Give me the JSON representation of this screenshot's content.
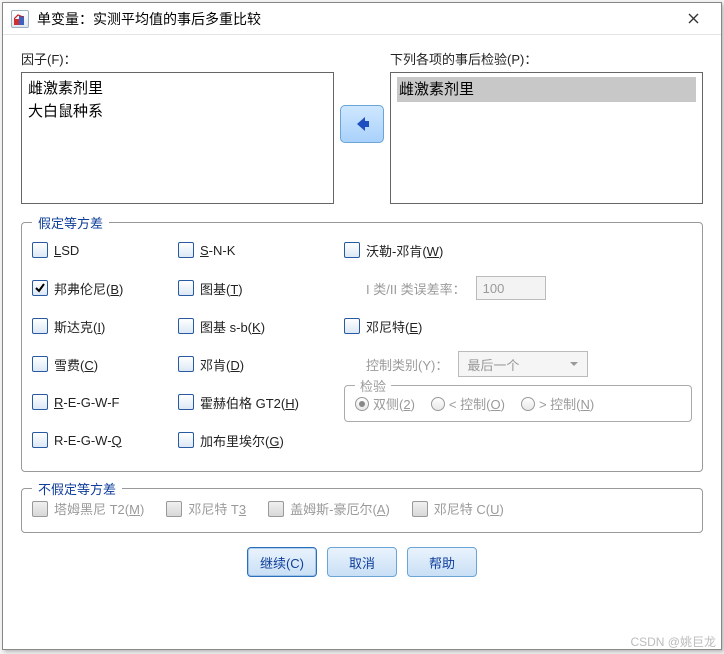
{
  "title": "单变量：实测平均值的事后多重比较",
  "factor_label": "因子(F)：",
  "factor_items": [
    "雌激素剂里",
    "大白鼠种系"
  ],
  "posthoc_label": "下列各项的事后检验(P)：",
  "posthoc_items": [
    "雌激素剂里"
  ],
  "group1": {
    "legend": "假定等方差",
    "col1": [
      "LSD",
      "邦弗伦尼(B)",
      "斯达克(I)",
      "雪费(C)",
      "R-E-G-W-F",
      "R-E-G-W-Q"
    ],
    "col2": [
      "S-N-K",
      "图基(T)",
      "图基 s-b(K)",
      "邓肯(D)",
      "霍赫伯格 GT2(H)",
      "加布里埃尔(G)"
    ],
    "col3_waller": "沃勒-邓肯(W)",
    "col3_err_label": "I 类/II 类误差率：",
    "col3_err_value": "100",
    "col3_dunnett": "邓尼特(E)",
    "col3_ctrl_label": "控制类别(Y)：",
    "col3_ctrl_value": "最后一个",
    "test_legend": "检验",
    "test_opts": [
      "双侧(2)",
      "< 控制(O)",
      "> 控制(N)"
    ]
  },
  "group2": {
    "legend": "不假定等方差",
    "opts": [
      "塔姆黑尼 T2(M)",
      "邓尼特 T3",
      "盖姆斯-豪厄尔(A)",
      "邓尼特 C(U)"
    ]
  },
  "buttons": {
    "ok": "继续(C)",
    "cancel": "取消",
    "help": "帮助"
  },
  "watermark": "CSDN @姚巨龙"
}
